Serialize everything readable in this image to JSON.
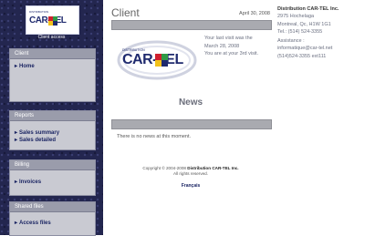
{
  "sidebar": {
    "logo_text": "CAR-TEL",
    "logo_small": "DISTRIBUTION",
    "client_access": "Client access",
    "panels": [
      {
        "title": "Client",
        "items": [
          "Home"
        ]
      },
      {
        "title": "Reports",
        "items": [
          "Sales summary",
          "Sales detailed"
        ]
      },
      {
        "title": "Billing",
        "items": [
          "Invoices"
        ]
      },
      {
        "title": "Shared files",
        "items": [
          "Access files"
        ]
      }
    ]
  },
  "main": {
    "title": "Client",
    "date": "April 30, 2008",
    "visit_line1": "Your last visit was the",
    "visit_line2": "March 28, 2008",
    "visit_line3": "You are at your 3rd visit.",
    "logo_small": "DISTRIBUTION",
    "logo_text": "CAR-TEL",
    "news_title": "News",
    "no_news": "There is no news at this moment.",
    "copyright_prefix": "Copyright © 2004-2008",
    "copyright_company": "Distribution CAR-TEL Inc.",
    "rights": "All rights reserved.",
    "language_link": "Français"
  },
  "company": {
    "name": "Distribution CAR-TEL Inc.",
    "address1": "2975 Hochelaga",
    "address2": "Montreal, Qc, H1W 1G1",
    "tel": "Tel.: (514) 524-3355",
    "assistance_label": "Assistance :",
    "email": "informatique@car-tel.net",
    "phone_ext": "(514)524-3355 ext111"
  },
  "colors": {
    "sidebar_bg": "#23264f",
    "panel_bg": "#c9cad2",
    "panel_header": "#9a9cab",
    "link": "#1b2563",
    "logo_red": "#d0202e",
    "logo_blue": "#1f2a6e",
    "logo_yellow": "#f2c21b",
    "logo_green": "#2f9a46"
  }
}
